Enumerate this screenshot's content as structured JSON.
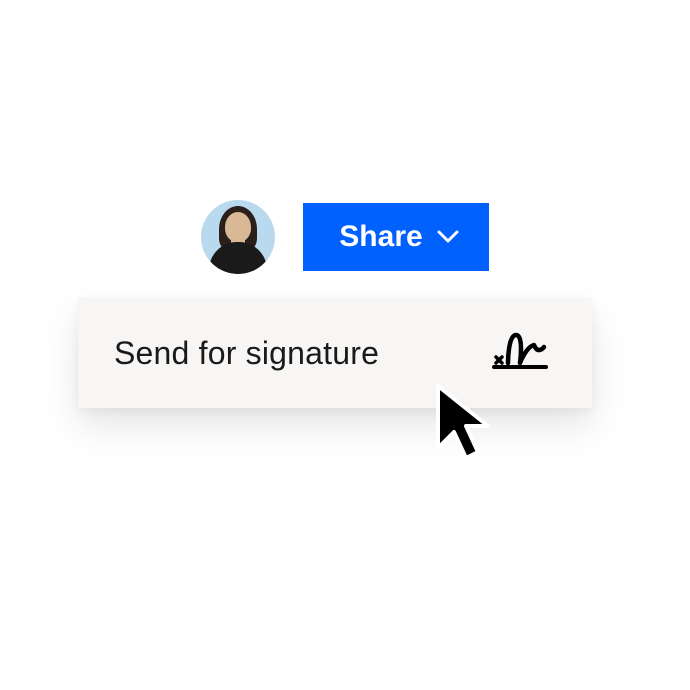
{
  "header": {
    "share_label": "Share"
  },
  "menu": {
    "send_for_signature_label": "Send for signature"
  },
  "icons": {
    "avatar": "user-avatar",
    "chevron": "chevron-down-icon",
    "signature": "signature-icon",
    "cursor": "cursor-icon"
  },
  "colors": {
    "primary": "#0061fe",
    "menu_bg": "#f8f6f4"
  }
}
